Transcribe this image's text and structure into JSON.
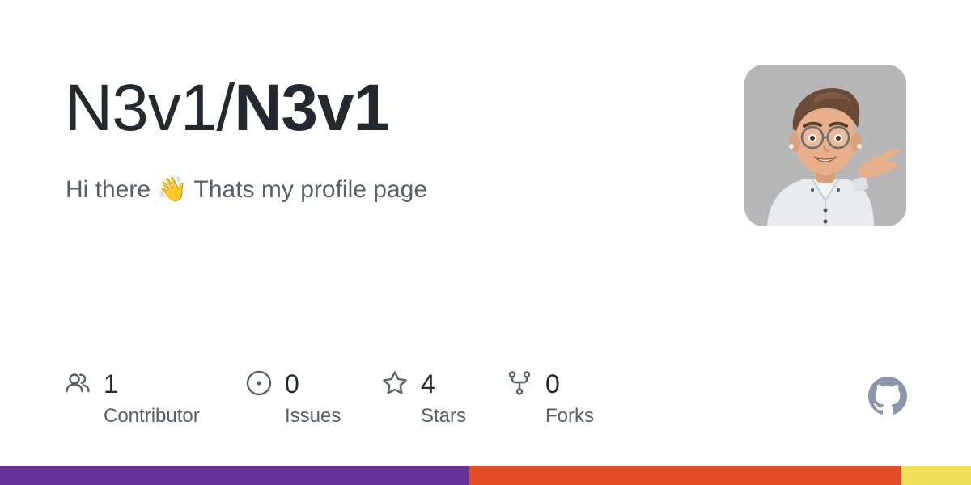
{
  "repo": {
    "owner": "N3v1/",
    "name": "N3v1",
    "description": "Hi there 👋 Thats my profile page"
  },
  "avatar": {
    "icon": "memoji-avatar",
    "background": "#b7b7b7"
  },
  "stats": {
    "contributors": {
      "value": "1",
      "label": "Contributor",
      "icon": "people-icon"
    },
    "issues": {
      "value": "0",
      "label": "Issues",
      "icon": "issue-opened-icon"
    },
    "stars": {
      "value": "4",
      "label": "Stars",
      "icon": "star-icon"
    },
    "forks": {
      "value": "0",
      "label": "Forks",
      "icon": "repo-forked-icon"
    }
  },
  "github_logo": {
    "icon": "github-mark-icon",
    "color": "#8b96ad"
  },
  "language_bar": [
    {
      "share": 0.4833,
      "color": "#663399"
    },
    {
      "share": 0.445,
      "color": "#e34c26"
    },
    {
      "share": 0.0717,
      "color": "#f1e05a"
    }
  ],
  "colors": {
    "text": "#24292f",
    "muted": "#57606a",
    "icon": "#57606a"
  }
}
